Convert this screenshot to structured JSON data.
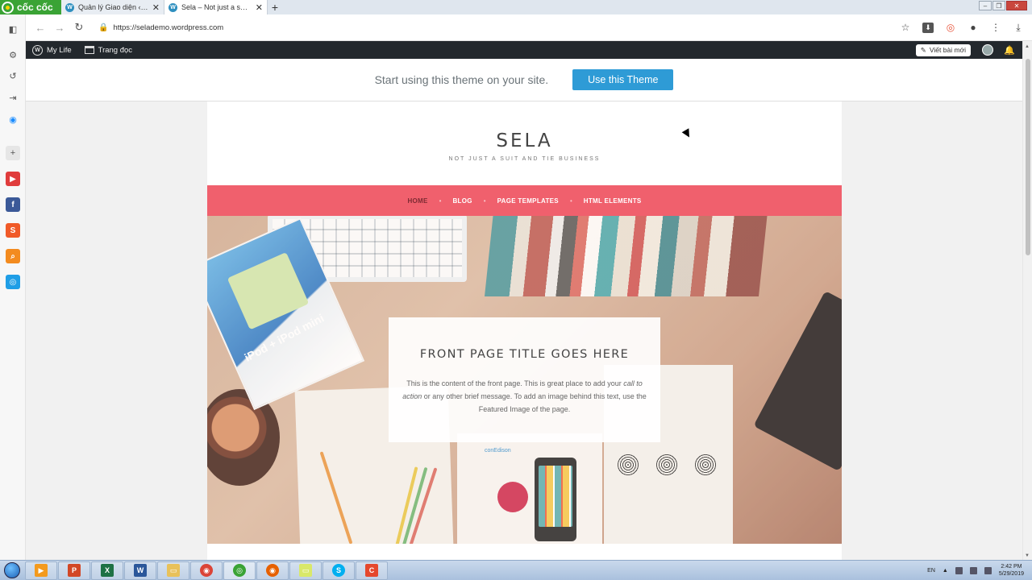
{
  "browser": {
    "brand": "cốc cốc",
    "tabs": [
      {
        "title": "Quản lý Giao diện ‹ Diarie"
      },
      {
        "title": "Sela – Not just a suit and tie business"
      }
    ],
    "url": "https://selademo.wordpress.com"
  },
  "adminbar": {
    "site": "My Life",
    "reader": "Trang đọc",
    "write": "Viết bài mới"
  },
  "banner": {
    "text": "Start using this theme on your site.",
    "button": "Use this Theme"
  },
  "site": {
    "title": "SELA",
    "tagline": "NOT JUST A SUIT AND TIE BUSINESS",
    "menu": [
      "HOME",
      "BLOG",
      "PAGE TEMPLATES",
      "HTML ELEMENTS"
    ]
  },
  "hero": {
    "card_text": "iPod + iPod mini",
    "logo_text": "conEdison",
    "title": "FRONT PAGE TITLE GOES HERE",
    "text_before": "This is the content of the front page. This is great place to add your ",
    "text_em": "call to action",
    "text_after": " or any other brief message. To add an image behind this text, use the Featured Image of the page."
  },
  "taskbar": {
    "lang": "EN",
    "time": "2:42 PM",
    "date": "5/29/2019"
  },
  "colors": {
    "menu": "#f0606d",
    "banner_button": "#2e9bd6",
    "adminbar": "#23282d"
  }
}
